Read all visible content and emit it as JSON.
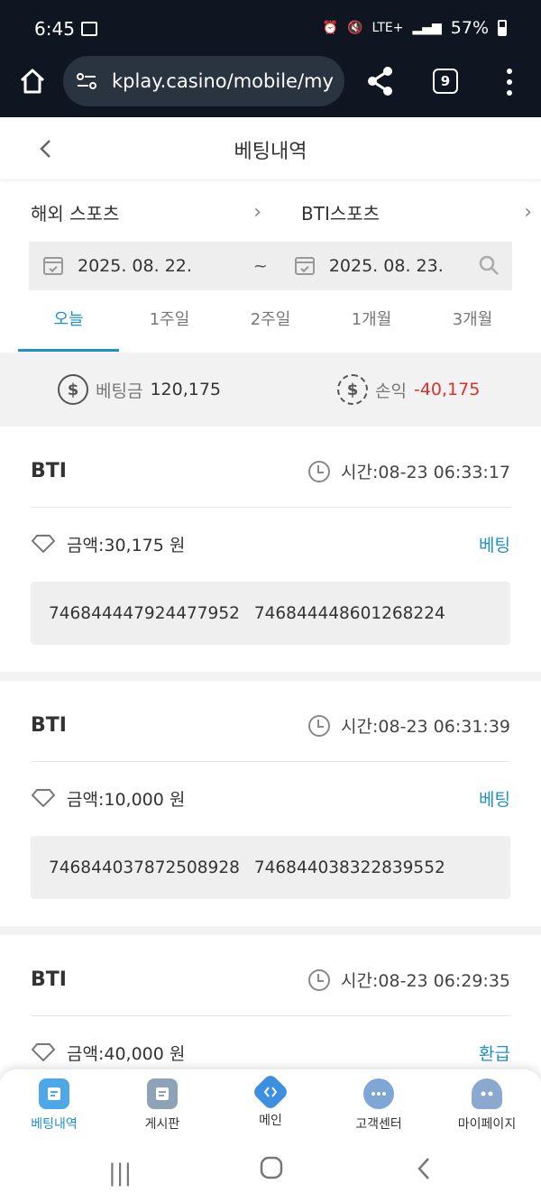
{
  "status_bar": {
    "time": "6:45",
    "network": "LTE+",
    "battery": "57%"
  },
  "browser": {
    "url": "kplay.casino/mobile/my",
    "tab_count": "9"
  },
  "header": {
    "title": "베팅내역"
  },
  "filters": {
    "category": "해외 스포츠",
    "provider": "BTI스포츠",
    "date_from": "2025. 08. 22.",
    "separator": "~",
    "date_to": "2025. 08. 23."
  },
  "period_tabs": [
    {
      "label": "오늘",
      "active": true
    },
    {
      "label": "1주일",
      "active": false
    },
    {
      "label": "2주일",
      "active": false
    },
    {
      "label": "1개월",
      "active": false
    },
    {
      "label": "3개월",
      "active": false
    }
  ],
  "summary": {
    "bet_label": "베팅금",
    "bet_value": "120,175",
    "pl_label": "손익",
    "pl_value": "-40,175"
  },
  "bets": [
    {
      "provider": "BTI",
      "time": "시간:08-23 06:33:17",
      "amount": "금액:30,175 원",
      "status": "베팅",
      "ids": [
        "746844447924477952",
        "746844448601268224"
      ]
    },
    {
      "provider": "BTI",
      "time": "시간:08-23 06:31:39",
      "amount": "금액:10,000 원",
      "status": "베팅",
      "ids": [
        "746844037872508928",
        "746844038322839552"
      ]
    },
    {
      "provider": "BTI",
      "time": "시간:08-23 06:29:35",
      "amount": "금액:40,000 원",
      "status": "환급",
      "ids": []
    }
  ],
  "bottom_nav": [
    {
      "label": "베팅내역",
      "icon": "betting-history-icon",
      "active": true
    },
    {
      "label": "게시판",
      "icon": "board-icon",
      "active": false
    },
    {
      "label": "메인",
      "icon": "main-icon",
      "active": false
    },
    {
      "label": "고객센터",
      "icon": "support-chat-icon",
      "active": false
    },
    {
      "label": "마이페이지",
      "icon": "mypage-icon",
      "active": false
    }
  ],
  "colors": {
    "accent": "#1e90cc",
    "negative": "#d9302b",
    "browser_bg": "#0f1621"
  }
}
